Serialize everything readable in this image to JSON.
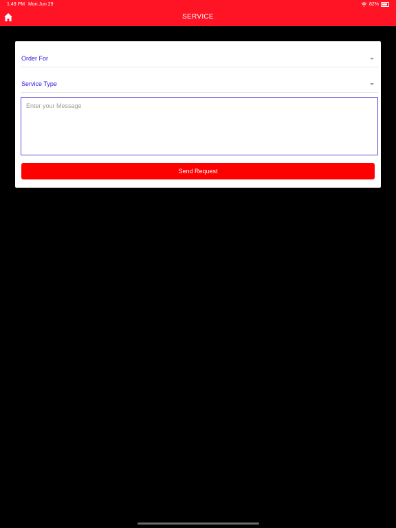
{
  "status_bar": {
    "time": "1:49 PM",
    "date": "Mon Jun 29",
    "battery": "82%",
    "battery_level": 0.82
  },
  "header": {
    "title": "SERVICE",
    "home_icon": "home-icon",
    "background_color": "#ff1426"
  },
  "form": {
    "order_for_label": "Order For",
    "service_type_label": "Service Type",
    "message_placeholder": "Enter your Message",
    "send_button_label": "Send Request",
    "accent_color": "#2a1ad6",
    "button_color": "#ff0000"
  }
}
